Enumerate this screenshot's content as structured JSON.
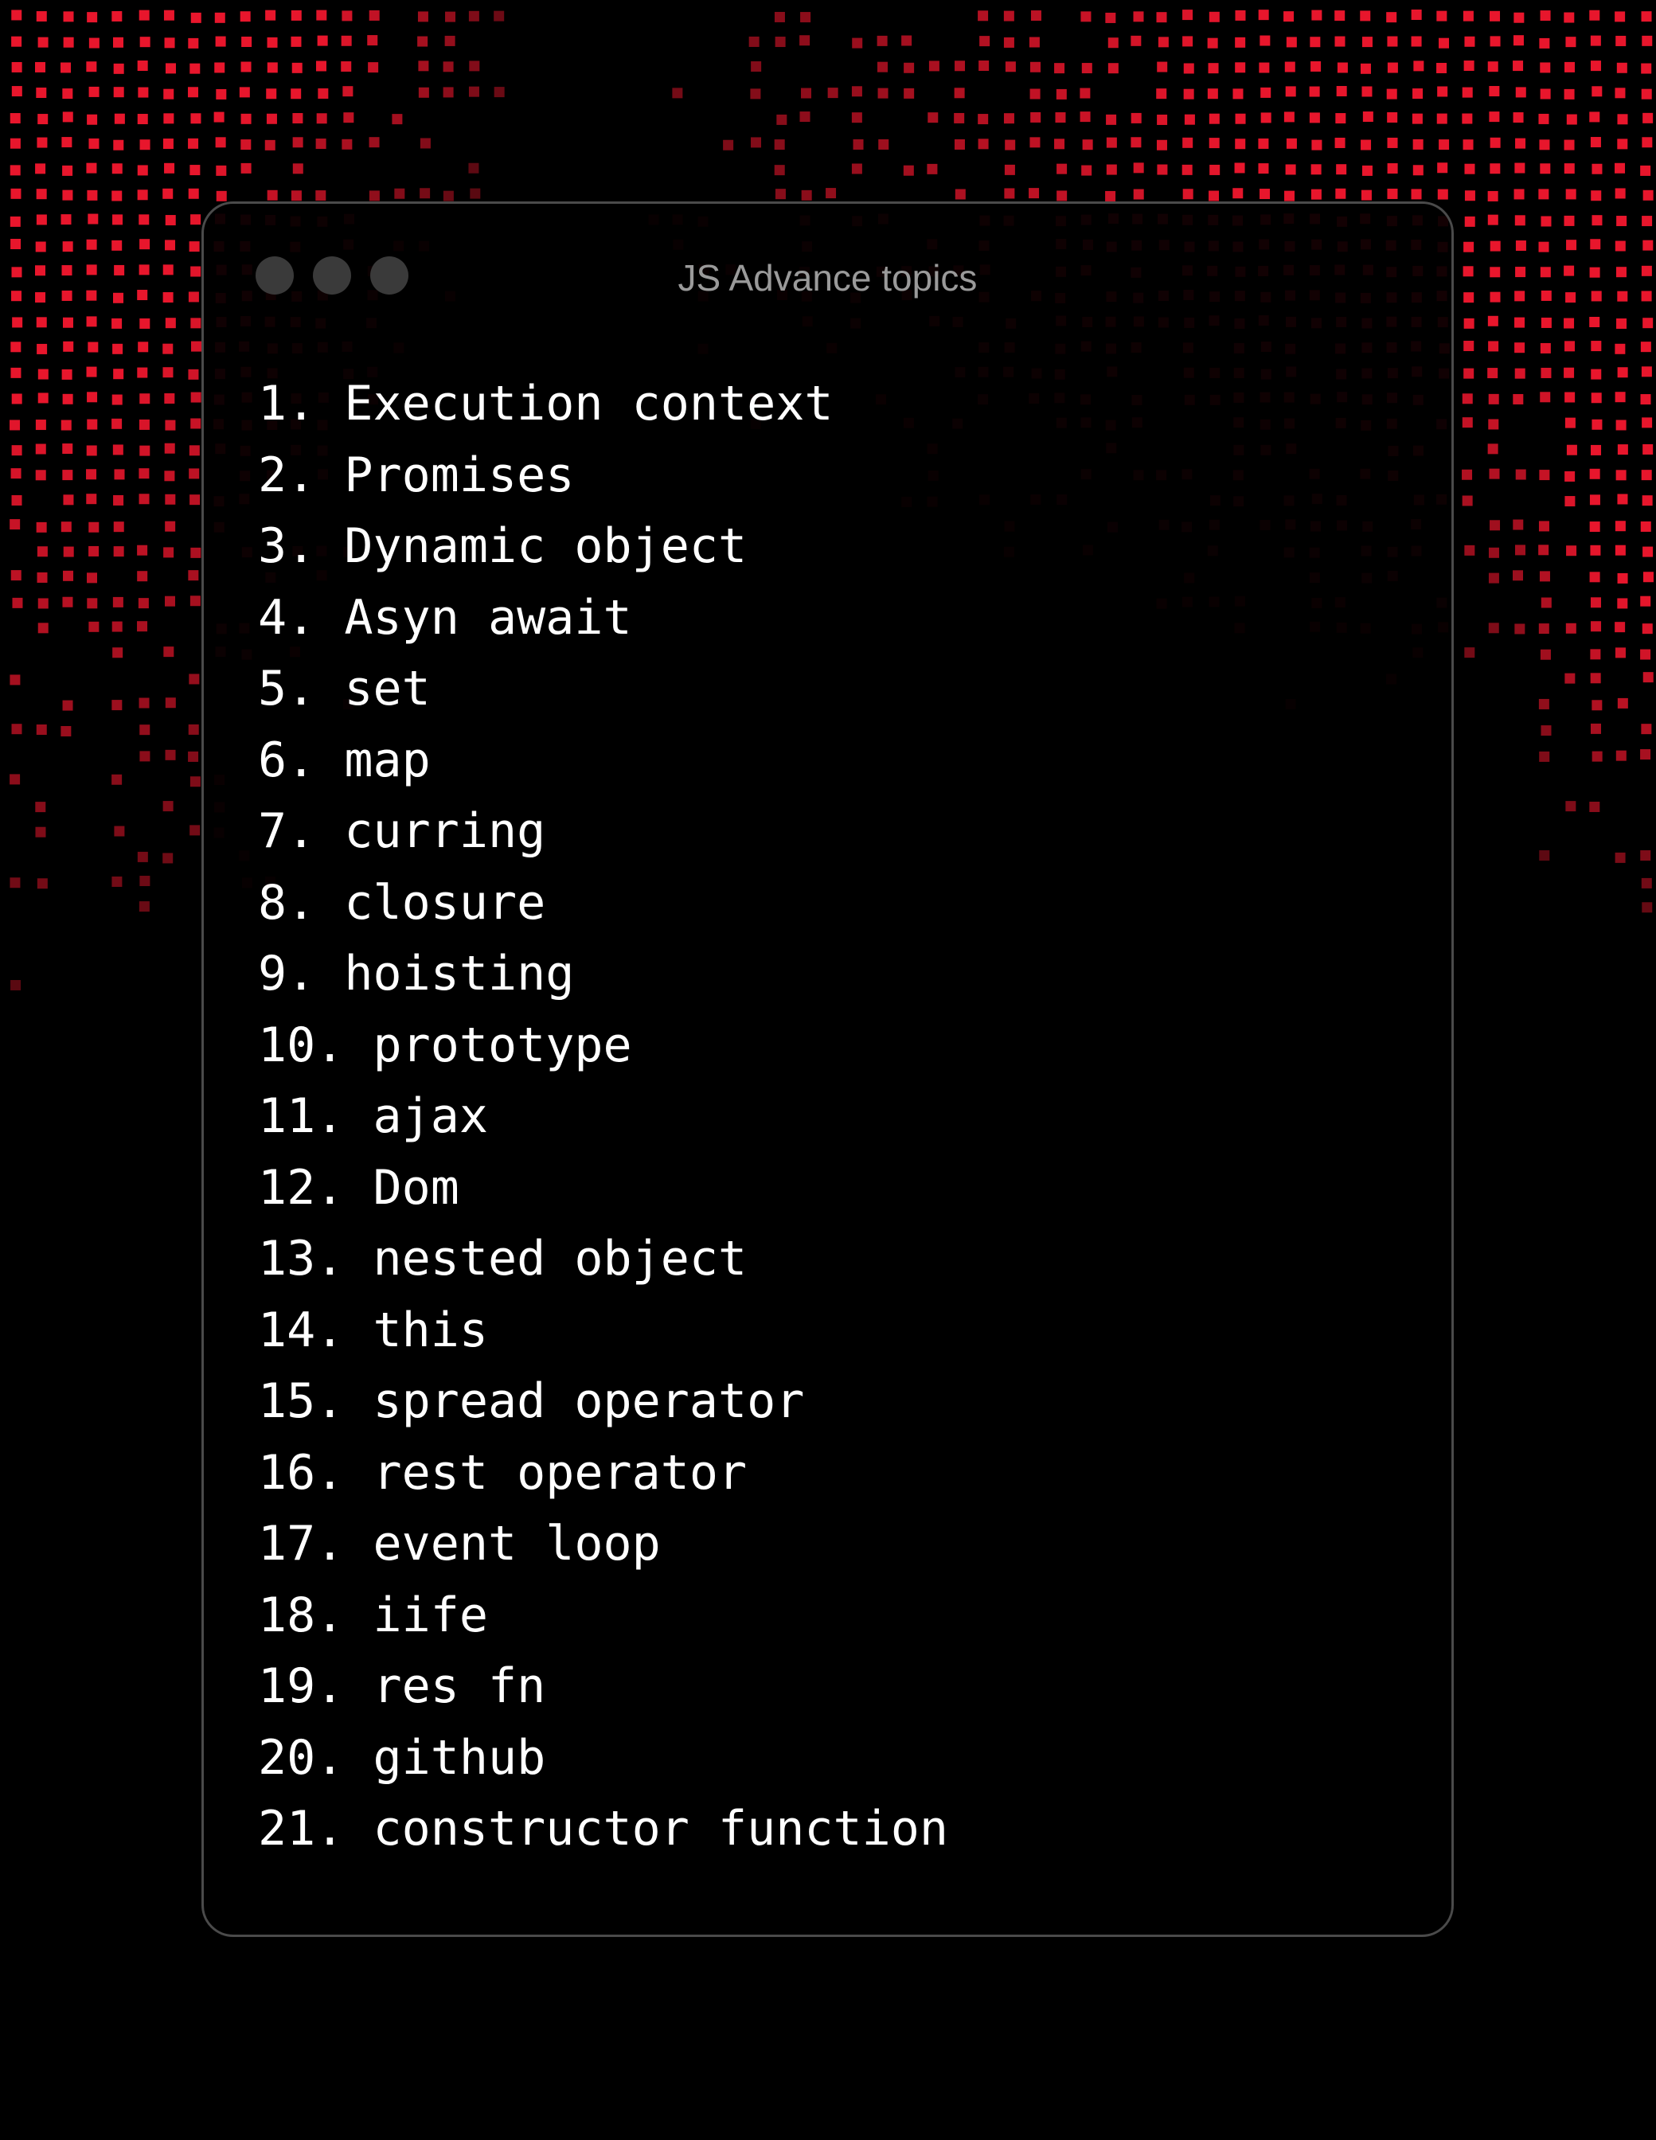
{
  "window": {
    "title": "JS Advance topics",
    "controls": [
      "close-dot",
      "minimize-dot",
      "maximize-dot"
    ]
  },
  "topics": [
    "1. Execution context",
    "2. Promises",
    "3. Dynamic object",
    "4. Asyn await",
    "5. set",
    "6. map",
    "7. curring",
    "8. closure",
    "9. hoisting",
    "10. prototype",
    "11. ajax",
    "12. Dom",
    "13. nested object",
    "14. this",
    "15. spread operator",
    "16. rest operator",
    "17. event loop",
    "18. iife",
    "19. res fn",
    "20. github",
    "21. constructor function"
  ],
  "colors": {
    "background": "#000000",
    "pattern": "#e8162c",
    "window_border": "#4a4a4a",
    "dots": "#3a3a3a",
    "title_text": "#9a9a9a",
    "list_text": "#ffffff"
  }
}
